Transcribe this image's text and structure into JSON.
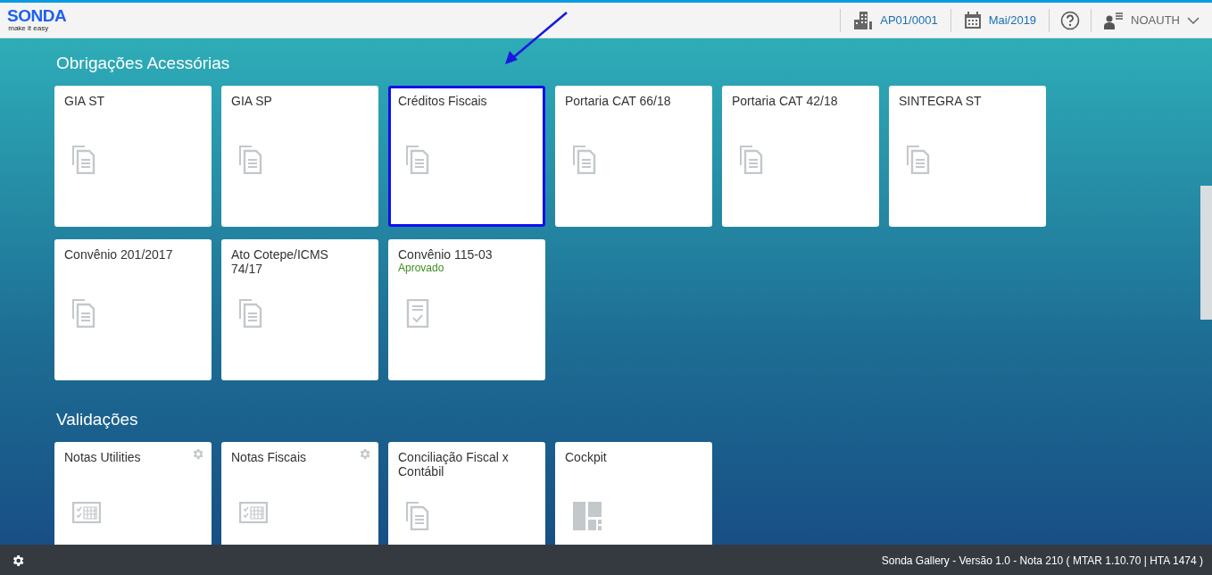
{
  "header": {
    "logo": "SONDA",
    "tagline": "make it easy",
    "company": "AP01/0001",
    "period": "Mai/2019",
    "user": "NOAUTH"
  },
  "sections": [
    {
      "title": "Obrigações Acessórias",
      "tiles": [
        {
          "title": "GIA ST",
          "kind": "documents",
          "settings": false,
          "selected": false
        },
        {
          "title": "GIA SP",
          "kind": "documents",
          "settings": false,
          "selected": false
        },
        {
          "title": "Créditos Fiscais",
          "kind": "documents",
          "settings": false,
          "selected": true
        },
        {
          "title": "Portaria CAT 66/18",
          "kind": "documents",
          "settings": false,
          "selected": false
        },
        {
          "title": "Portaria CAT 42/18",
          "kind": "documents",
          "settings": false,
          "selected": false
        },
        {
          "title": "SINTEGRA ST",
          "kind": "documents",
          "settings": false,
          "selected": false
        },
        {
          "title": "Convênio 201/2017",
          "kind": "documents",
          "settings": false,
          "selected": false
        },
        {
          "title": "Ato Cotepe/ICMS 74/17",
          "kind": "documents",
          "settings": false,
          "selected": false
        },
        {
          "title": "Convênio 115-03",
          "status": "Aprovado",
          "kind": "approved",
          "settings": false,
          "selected": false
        }
      ]
    },
    {
      "title": "Validações",
      "tiles": [
        {
          "title": "Notas Utilities",
          "kind": "table",
          "settings": true,
          "selected": false
        },
        {
          "title": "Notas Fiscais",
          "kind": "table",
          "settings": true,
          "selected": false
        },
        {
          "title": "Conciliação Fiscal x Contábil",
          "kind": "documents",
          "settings": false,
          "selected": false
        },
        {
          "title": "Cockpit",
          "kind": "dashboard",
          "settings": false,
          "selected": false
        }
      ]
    }
  ],
  "footer": {
    "text": "Sonda Gallery - Versão 1.0 - Nota 210 ( MTAR 1.10.70 | HTA 1474 )"
  }
}
